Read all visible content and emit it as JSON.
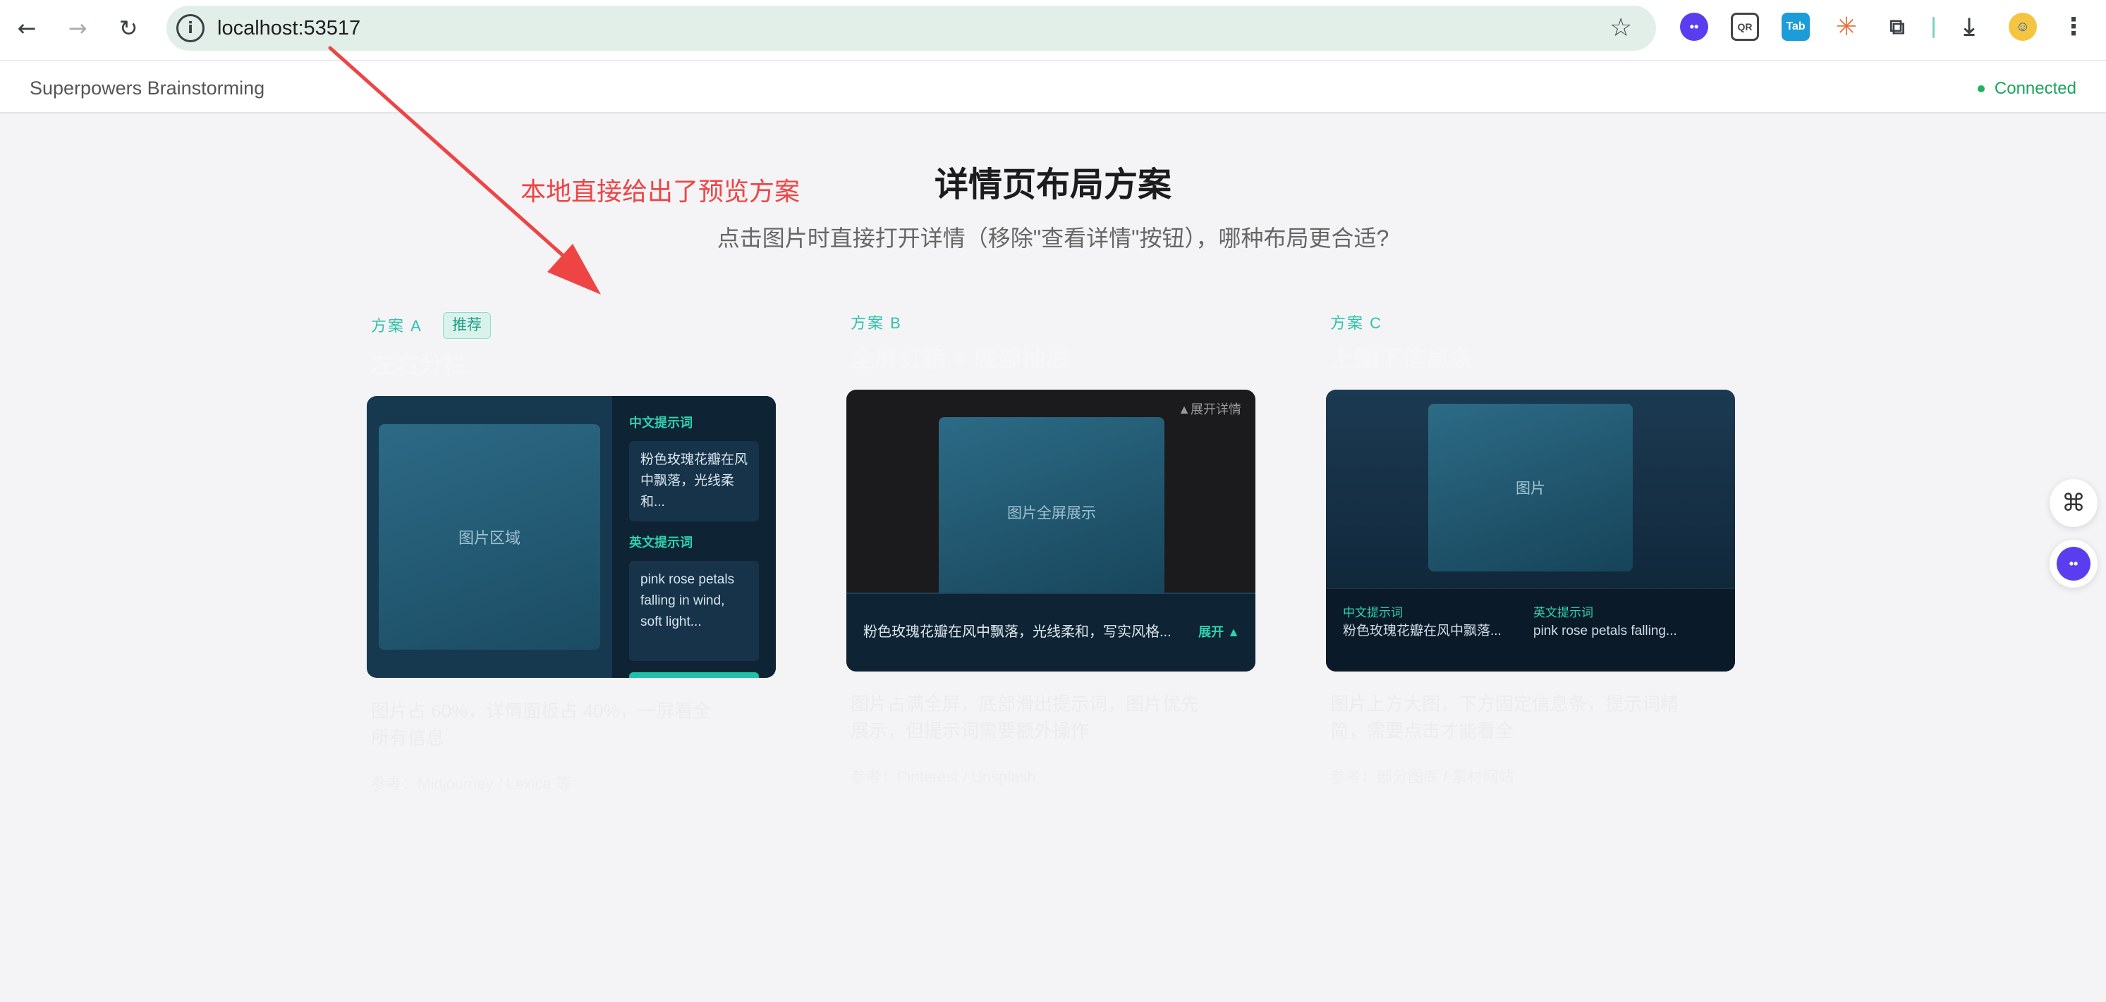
{
  "browser": {
    "url": "localhost:53517",
    "icons": {
      "back": "←",
      "forward": "→",
      "reload": "↻",
      "info": "i",
      "star": "☆",
      "monster_ext": "••",
      "qr_ext": "QR",
      "tab_ext": "Tab",
      "burst_ext": "✳",
      "puzzle_ext": "⧉",
      "download": "⤓",
      "avatar": "☺",
      "menu": "⋮"
    }
  },
  "app": {
    "title": "Superpowers Brainstorming",
    "status": "Connected"
  },
  "annotation": {
    "text": "本地直接给出了预览方案",
    "color": "#ef4444"
  },
  "page": {
    "title": "详情页布局方案",
    "subtitle": "点击图片时直接打开详情（移除\"查看详情\"按钮），哪种布局更合适?"
  },
  "options": [
    {
      "label": "方案 A",
      "badge": "推荐",
      "title": "左右分栏",
      "description": "图片占 60%，详情面板占 40%，一屏看全所有信息",
      "footer": "参考：Midjourney / Lexica 等",
      "preview": {
        "image_label": "图片区域",
        "cn_label": "中文提示词",
        "cn_text": "粉色玫瑰花瓣在风中飘落，光线柔和...",
        "en_label": "英文提示词",
        "en_text": "pink rose petals falling in wind, soft light..."
      }
    },
    {
      "label": "方案 B",
      "title": "全屏灯箱 + 底部抽屉",
      "description": "图片占满全屏，底部滑出提示词，图片优先展示，但提示词需要额外操作",
      "footer": "参考：Pinterest / Unsplash",
      "preview": {
        "image_label": "图片全屏展示",
        "expand_top": "▲展开详情",
        "drawer_text": "粉色玫瑰花瓣在风中飘落，光线柔和，写实风格...",
        "expand": "展开 ▲"
      }
    },
    {
      "label": "方案 C",
      "title": "上图下信息条",
      "description": "图片上方大图，下方固定信息条，提示词精简，需要点击才能看全",
      "footer": "参考：部分图库 / 素材网站",
      "preview": {
        "image_label": "图片",
        "cn_label": "中文提示词",
        "cn_text": "粉色玫瑰花瓣在风中飘落...",
        "en_label": "英文提示词",
        "en_text": "pink rose petals falling..."
      }
    }
  ],
  "floating": {
    "cmd_icon": "⌘",
    "assistant_icon": "••"
  }
}
